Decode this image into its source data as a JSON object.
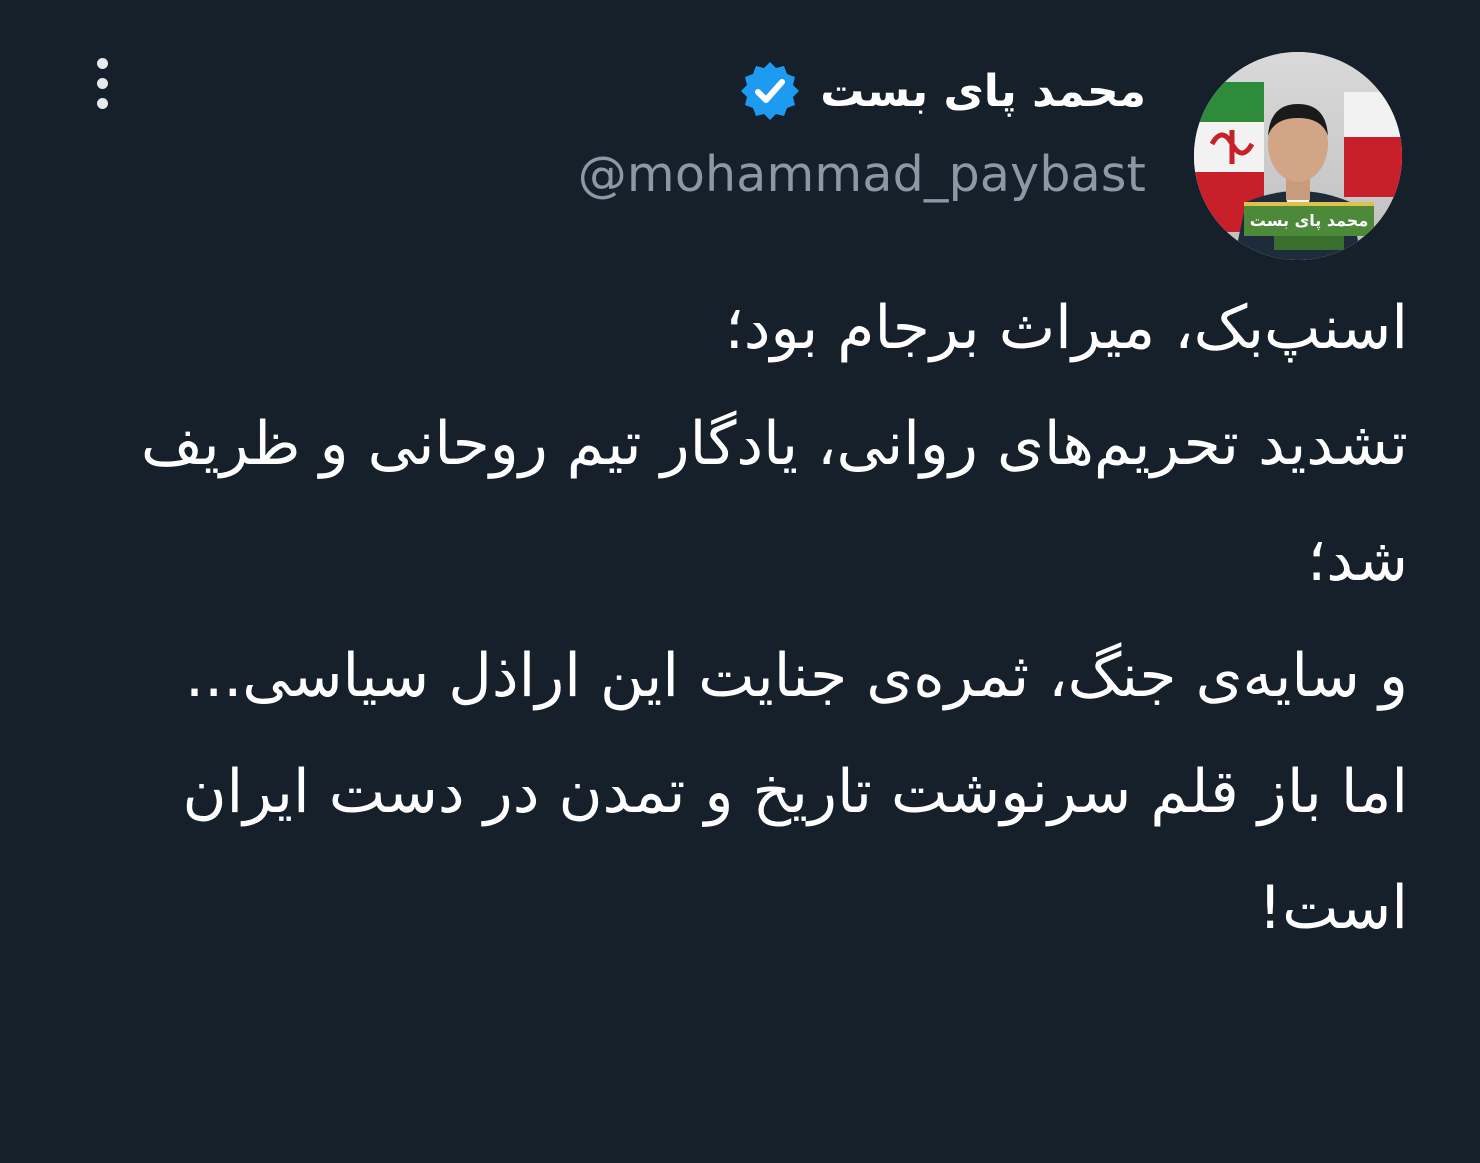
{
  "tweet": {
    "author": {
      "display_name": "محمد پای بست",
      "handle": "@mohammad_paybast",
      "verified": true,
      "avatar_caption": "محمد پای بست"
    },
    "text": "اسنپ‌بک، میراث برجام بود؛\nتشدید تحریم‌های روانی، یادگار تیم روحانی و ظریف شد؛\nو سایه‌ی جنگ، ثمره‌ی جنایت این اراذل سیاسی...\nاما باز قلم سرنوشت تاریخ و تمدن در دست ایران است!"
  },
  "icons": {
    "more": "more-vertical-icon",
    "verified": "verified-badge-icon"
  },
  "colors": {
    "background": "#15202b",
    "primary_text": "#ffffff",
    "secondary_text": "#8b98a5",
    "verified_blue": "#1d9bf0"
  }
}
